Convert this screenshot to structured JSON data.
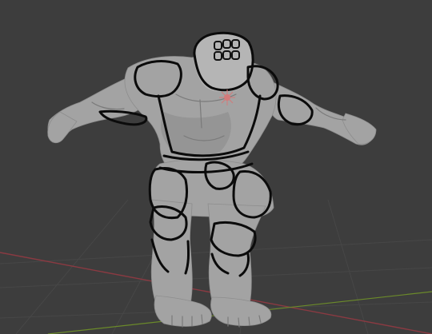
{
  "viewport": {
    "background": "#3d3d3d",
    "grid_color": "#474747",
    "x_axis_color": "#8a3a42",
    "y_axis_color": "#6b8a2a"
  },
  "model": {
    "skin_color": "#a3a3a3",
    "stroke_color": "#0b0b0b",
    "origin_color": "#d47a7a"
  }
}
